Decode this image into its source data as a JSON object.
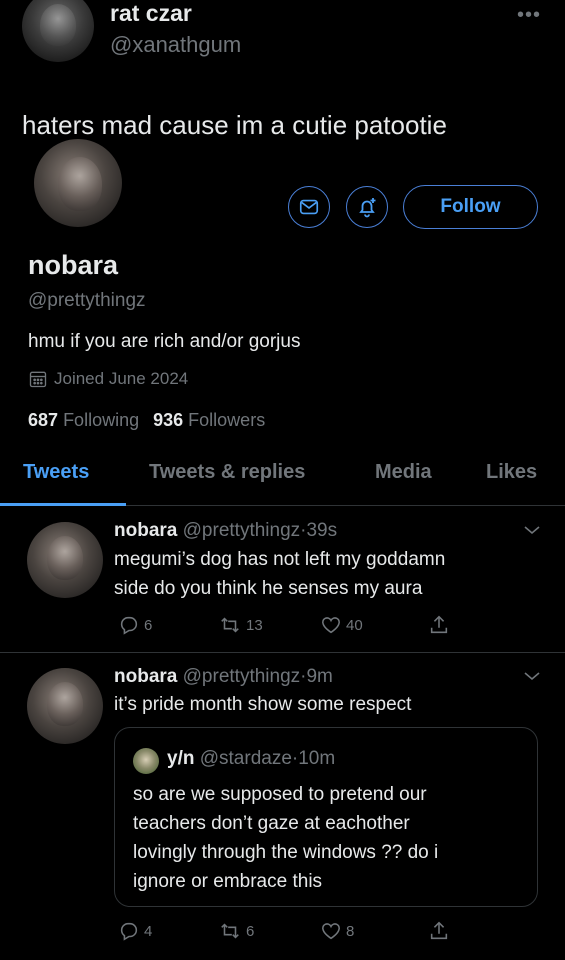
{
  "top_post": {
    "name": "rat czar",
    "handle": "@xanathgum",
    "more": "•••",
    "text": "haters mad cause im a cutie patootie"
  },
  "profile": {
    "follow_label": "Follow",
    "name": "nobara",
    "handle": "@prettythingz",
    "bio": "hmu if you are rich and/or gorjus",
    "joined": "Joined June 2024",
    "following_count": "687",
    "following_label": "Following",
    "followers_count": "936",
    "followers_label": "Followers"
  },
  "tabs": [
    {
      "label": "Tweets",
      "active": true
    },
    {
      "label": "Tweets & replies",
      "active": false
    },
    {
      "label": "Media",
      "active": false
    },
    {
      "label": "Likes",
      "active": false
    }
  ],
  "tweets": [
    {
      "name": "nobara",
      "handle": "@prettythingz",
      "time": "39s",
      "text_line1": "megumi’s dog has not left my goddamn",
      "text_line2": "side do you think he senses my aura",
      "replies": "6",
      "retweets": "13",
      "likes": "40"
    },
    {
      "name": "nobara",
      "handle": "@prettythingz",
      "time": "9m",
      "text": "it’s pride month show some respect",
      "replies": "4",
      "retweets": "6",
      "likes": "8",
      "quote": {
        "name": "y/n",
        "handle": "@stardaze",
        "time": "10m",
        "line1": "so are we supposed to pretend our",
        "line2": "teachers don’t gaze at eachother",
        "line3": "lovingly through the windows ?? do i",
        "line4": "ignore or embrace this"
      }
    }
  ],
  "colors": {
    "background": "#000000",
    "text": "#e7e9ea",
    "muted": "#71767b",
    "accent": "#4a9ff5",
    "border": "#2f3336"
  }
}
